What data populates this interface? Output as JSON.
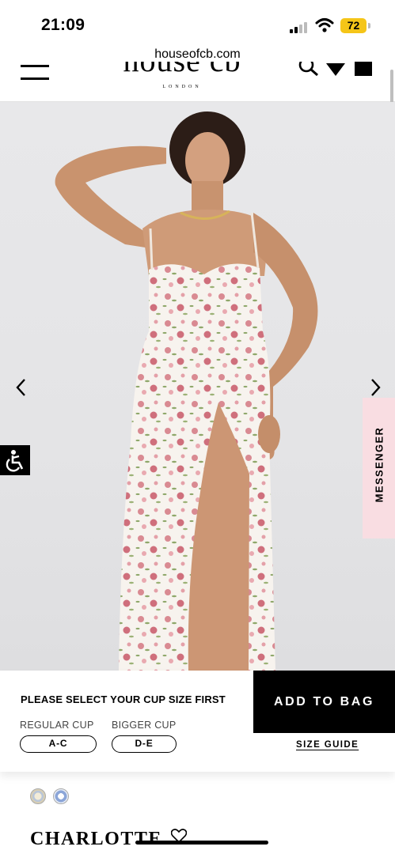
{
  "status_bar": {
    "time": "21:09",
    "battery": "72"
  },
  "browser": {
    "url": "houseofcb.com"
  },
  "header": {
    "logo": "house cb",
    "logo_sub": "LONDON"
  },
  "floating": {
    "messenger_label": "MESSENGER"
  },
  "purchase_panel": {
    "prompt": "PLEASE SELECT YOUR CUP SIZE FIRST",
    "regular_cup_label": "REGULAR CUP",
    "regular_cup_value": "A-C",
    "bigger_cup_label": "BIGGER CUP",
    "bigger_cup_value": "D-E",
    "add_to_bag": "ADD TO BAG",
    "size_guide": "SIZE GUIDE"
  },
  "product": {
    "name": "CHARLOTTE"
  },
  "icons": [
    "hamburger-icon",
    "search-icon",
    "heart-icon",
    "bag-icon",
    "chevron-left-icon",
    "chevron-right-icon",
    "accessibility-icon",
    "wifi-icon",
    "signal-icon"
  ],
  "colors": {
    "accent_black": "#000000",
    "messenger_bg": "#f9dde2",
    "battery": "#f5c518"
  }
}
